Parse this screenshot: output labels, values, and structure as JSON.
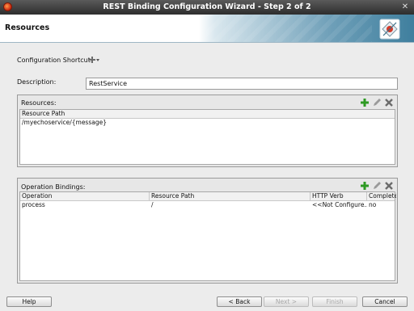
{
  "window": {
    "title": "REST Binding Configuration Wizard - Step 2 of 2"
  },
  "banner": {
    "title": "Resources"
  },
  "form": {
    "shortcut_label": "Configuration Shortcut:",
    "description_label": "Description:",
    "description_value": "RestService"
  },
  "resources": {
    "title": "Resources:",
    "columns": [
      "Resource Path"
    ],
    "rows": [
      [
        "/myechoservice/{message}"
      ]
    ]
  },
  "operations": {
    "title": "Operation Bindings:",
    "columns": [
      "Operation",
      "Resource Path",
      "HTTP Verb",
      "Complete"
    ],
    "rows": [
      [
        "process",
        "/",
        "<<Not Configure...",
        "no"
      ]
    ]
  },
  "buttons": {
    "help": "Help",
    "back": "< Back",
    "next": "Next >",
    "finish": "Finish",
    "cancel": "Cancel"
  },
  "colors": {
    "add": "#2e9a23",
    "edit": "#8a8a8a",
    "delete": "#6b6b6b"
  }
}
